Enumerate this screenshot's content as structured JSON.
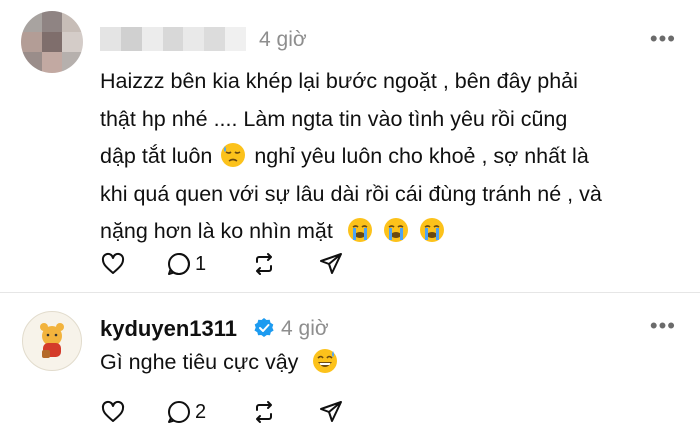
{
  "colors": {
    "text": "#101010",
    "muted": "#8e8e8e",
    "verified": "#1d9bf0",
    "divider": "#e6e6e6"
  },
  "posts": [
    {
      "author": "",
      "time": "4 giờ",
      "lines": [
        "Haizzz bên kia khép lại bước ngoặt , bên đây phải",
        "thật hp nhé .... Làm ngta tin vào tình yêu rồi cũng",
        "dập tắt luôn",
        "nghỉ yêu luôn cho khoẻ , sợ nhất là",
        "khi quá quen với sự lâu dài rồi cái đùng tránh né , và",
        "nặng hơn là ko nhìn mặt"
      ],
      "actions": {
        "like_count": "",
        "reply_count": "1",
        "repost_count": "",
        "share_count": ""
      },
      "icons": [
        "heart-icon",
        "reply-icon",
        "repost-icon",
        "share-icon",
        "more-icon"
      ]
    },
    {
      "author": "kyduyen1311",
      "time": "4 giờ",
      "text": "Gì nghe tiêu cực vậy",
      "actions": {
        "like_count": "",
        "reply_count": "2",
        "repost_count": "",
        "share_count": ""
      },
      "icons": [
        "heart-icon",
        "reply-icon",
        "repost-icon",
        "share-icon",
        "more-icon",
        "verified-badge-icon"
      ]
    }
  ],
  "ui": {
    "more": "•••"
  }
}
